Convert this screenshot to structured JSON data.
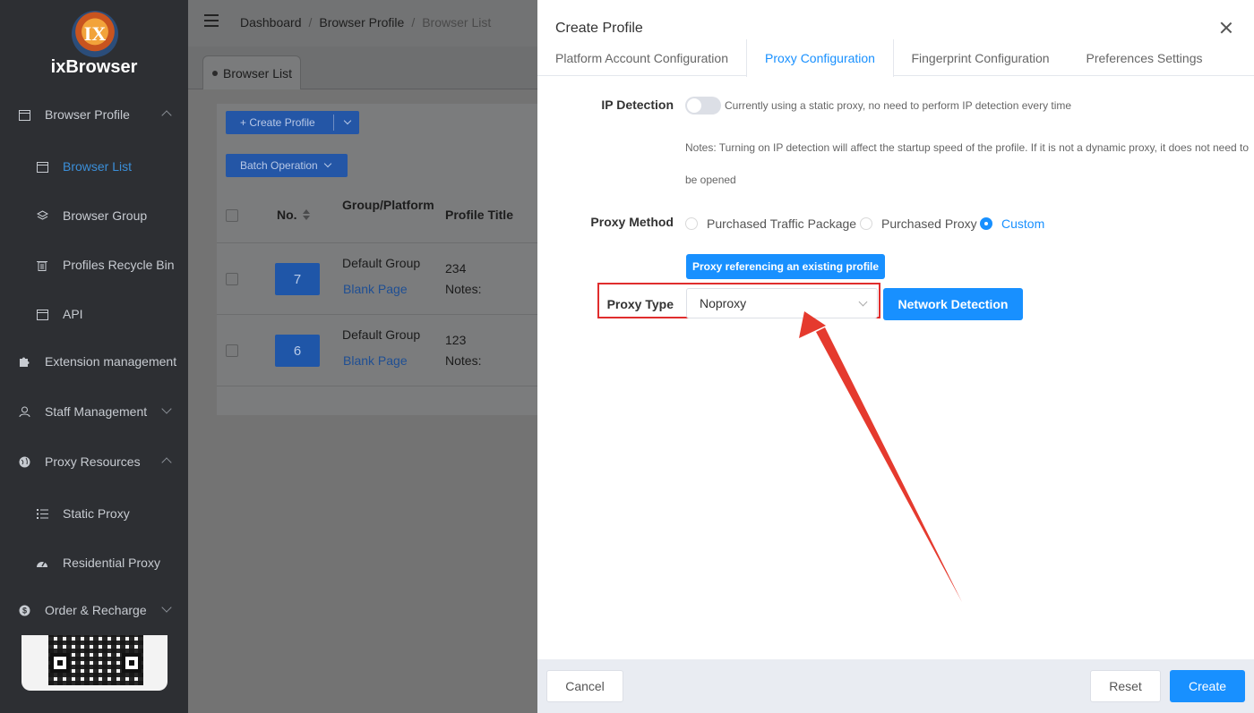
{
  "app": {
    "name": "ixBrowser",
    "logo_letters": "IX"
  },
  "sidebar": {
    "items": [
      {
        "label": "Browser Profile",
        "icon": "calendar-icon"
      },
      {
        "label": "Browser List",
        "icon": "calendar-icon",
        "active": true
      },
      {
        "label": "Browser Group",
        "icon": "layers-icon"
      },
      {
        "label": "Profiles Recycle Bin",
        "icon": "trash-icon"
      },
      {
        "label": "API",
        "icon": "calendar-icon"
      },
      {
        "label": "Extension management",
        "icon": "puzzle-icon"
      },
      {
        "label": "Staff Management",
        "icon": "user-icon"
      },
      {
        "label": "Proxy Resources",
        "icon": "globe-icon"
      },
      {
        "label": "Static Proxy",
        "icon": "list-icon"
      },
      {
        "label": "Residential Proxy",
        "icon": "dashboard-icon"
      },
      {
        "label": "Order & Recharge",
        "icon": "dollar-icon"
      }
    ]
  },
  "header": {
    "breadcrumb": [
      "Dashboard",
      "Browser Profile",
      "Browser List"
    ],
    "separator": "/"
  },
  "background": {
    "tab_label": "Browser List",
    "create_button": "+ Create Profile",
    "batch_button": "Batch Operation",
    "columns": [
      "No.",
      "Group/Platform",
      "Profile Title"
    ],
    "rows": [
      {
        "no": "7",
        "group": "Default Group",
        "platform": "Blank Page",
        "title": "234",
        "notes": "Notes:"
      },
      {
        "no": "6",
        "group": "Default Group",
        "platform": "Blank Page",
        "title": "123",
        "notes": "Notes:"
      }
    ]
  },
  "drawer": {
    "title": "Create Profile",
    "tabs": [
      {
        "label": "Platform Account Configuration"
      },
      {
        "label": "Proxy Configuration",
        "active": true
      },
      {
        "label": "Fingerprint Configuration"
      },
      {
        "label": "Preferences Settings"
      }
    ],
    "ip_detection": {
      "label": "IP Detection",
      "enabled": false,
      "status_text": "Currently using a static proxy, no need to perform IP detection every time",
      "note": "Notes: Turning on IP detection will affect the startup speed of the profile. If it is not a dynamic proxy, it does not need to be opened"
    },
    "proxy_method": {
      "label": "Proxy Method",
      "options": [
        "Purchased Traffic Package",
        "Purchased Proxy",
        "Custom"
      ],
      "selected": "Custom"
    },
    "ref_button": "Proxy referencing an existing profile",
    "proxy_type": {
      "label": "Proxy Type",
      "value": "Noproxy"
    },
    "network_button": "Network Detection",
    "footer": {
      "cancel": "Cancel",
      "reset": "Reset",
      "create": "Create"
    }
  },
  "colors": {
    "accent": "#1890ff",
    "highlight": "#e02d2d",
    "sidebar_bg": "#2d2f33"
  }
}
